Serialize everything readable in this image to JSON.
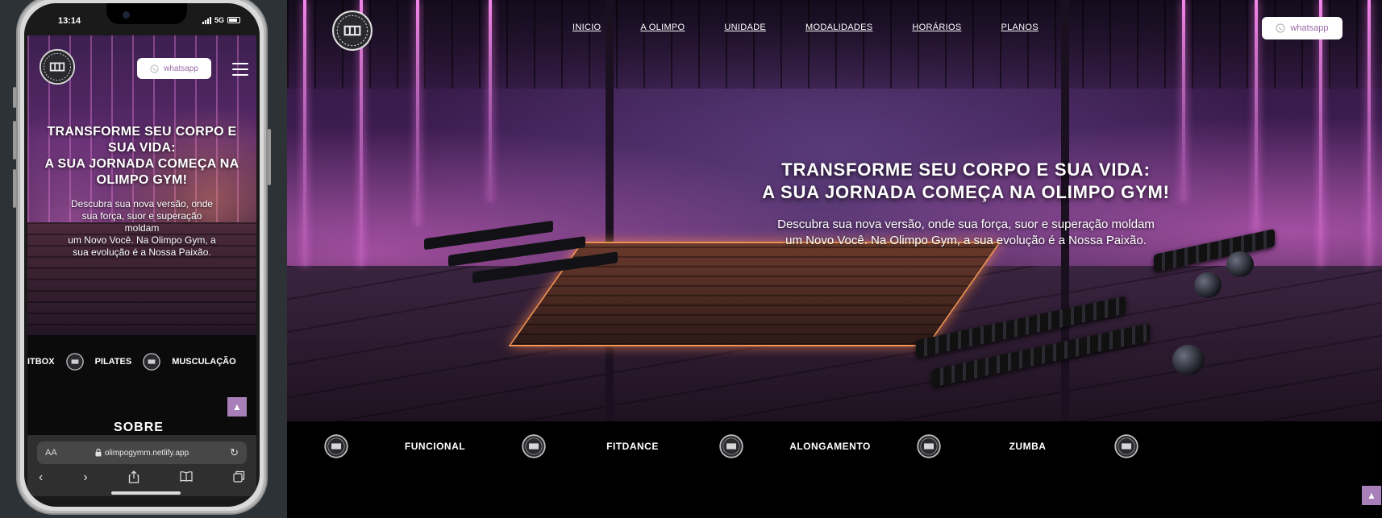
{
  "phone": {
    "status": {
      "time": "13:14",
      "network": "5G"
    },
    "header": {
      "whatsapp_label": "whatsapp"
    },
    "hero": {
      "title_lines": [
        "TRANSFORME SEU CORPO E",
        "SUA VIDA:",
        "A SUA JORNADA COMEÇA NA",
        "OLIMPO GYM!"
      ],
      "desc_lines": [
        "Descubra sua nova versão, onde",
        "sua força, suor e superação",
        "moldam",
        "um Novo Você. Na Olimpo Gym, a",
        "sua evolução é a Nossa Paixão."
      ]
    },
    "strip": [
      "RITBOX",
      "PILATES",
      "MUSCULAÇÃO"
    ],
    "section_title": "SOBRE",
    "browser": {
      "aa": "AA",
      "url": "olimpogymm.netlify.app"
    }
  },
  "desktop": {
    "nav": [
      "INICIO",
      "A OLIMPO",
      "UNIDADE",
      "MODALIDADES",
      "HORÁRIOS",
      "PLANOS"
    ],
    "whatsapp_label": "whatsapp",
    "hero": {
      "title_lines": [
        "TRANSFORME SEU CORPO E SUA VIDA:",
        "A SUA JORNADA COMEÇA NA OLIMPO GYM!"
      ],
      "desc_lines": [
        "Descubra sua nova versão, onde sua força, suor e superação moldam",
        "um Novo Você. Na Olimpo Gym, a sua evolução é a Nossa Paixão."
      ]
    },
    "strip": [
      "FUNCIONAL",
      "FITDANCE",
      "ALONGAMENTO",
      "ZUMBA"
    ]
  },
  "icons": {
    "logo": "olimpo-gym-emblem-icon",
    "whatsapp": "whatsapp-icon",
    "menu": "hamburger-menu-icon",
    "scroll_top": "arrow-up-icon",
    "lock": "lock-icon",
    "reload": "reload-icon",
    "back": "chevron-left-icon",
    "forward": "chevron-right-icon",
    "share": "share-icon",
    "bookmarks": "book-icon",
    "tabs": "tabs-icon"
  },
  "colors": {
    "accent": "#a87fb8",
    "whatsapp_text": "#9b6aa8",
    "neon": "#ff8cf5",
    "background": "#000000"
  }
}
